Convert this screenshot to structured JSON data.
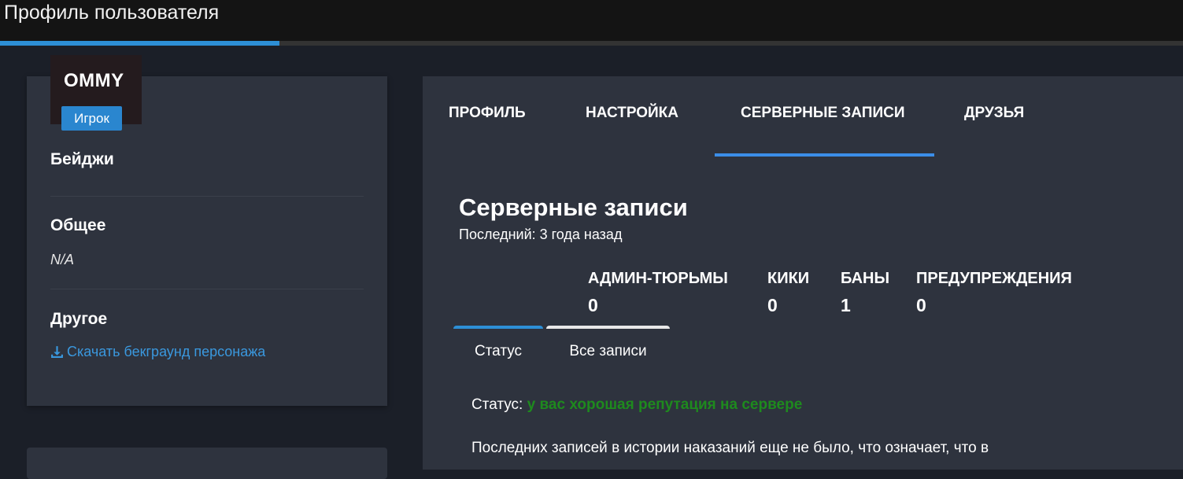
{
  "header": {
    "title": "Профиль пользователя",
    "progress_percent": 23.6,
    "accent_color": "#2d8fd6"
  },
  "profile": {
    "username": "OMMY",
    "role": "Игрок",
    "sections": {
      "badges_title": "Бейджи",
      "general_title": "Общее",
      "general_value": "N/A",
      "other_title": "Другое",
      "download_link": "Скачать бекграунд персонажа",
      "download_icon": "download-icon"
    }
  },
  "tabs": [
    {
      "label": "ПРОФИЛЬ",
      "active": false
    },
    {
      "label": "НАСТРОЙКА",
      "active": false
    },
    {
      "label": "СЕРВЕРНЫЕ ЗАПИСИ",
      "active": true
    },
    {
      "label": "ДРУЗЬЯ",
      "active": false
    }
  ],
  "records": {
    "title": "Серверные записи",
    "last": "Последний: 3 года назад",
    "stats": [
      {
        "label": "АДМИН-ТЮРЬМЫ",
        "value": "0"
      },
      {
        "label": "КИКИ",
        "value": "0"
      },
      {
        "label": "БАНЫ",
        "value": "1"
      },
      {
        "label": "ПРЕДУПРЕЖДЕНИЯ",
        "value": "0"
      }
    ],
    "subtabs": [
      {
        "label": "Статус",
        "active": true
      },
      {
        "label": "Все записи",
        "active": false
      }
    ],
    "status_label": "Статус:",
    "status_value": "у вас хорошая репутация на сервере",
    "status_color": "#1e8a1e",
    "history_text": "Последних записей в истории наказаний еще не было, что означает, что в"
  }
}
